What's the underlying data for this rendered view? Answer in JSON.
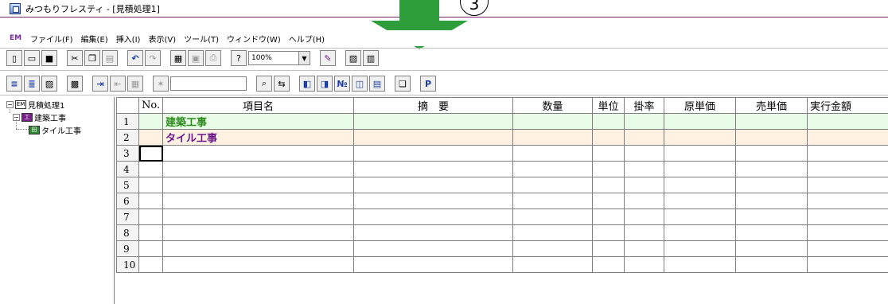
{
  "window": {
    "title": "みつもりフレスティ - [見積処理1]"
  },
  "annotation": {
    "label": "3"
  },
  "menu": [
    {
      "label": "ファイル(F)"
    },
    {
      "label": "編集(E)"
    },
    {
      "label": "挿入(I)"
    },
    {
      "label": "表示(V)"
    },
    {
      "label": "ツール(T)"
    },
    {
      "label": "ウィンドウ(W)"
    },
    {
      "label": "ヘルプ(H)"
    }
  ],
  "toolbar": {
    "zoom": "100%"
  },
  "tree": {
    "root": "見積処理1",
    "child": "建築工事",
    "grandchild": "タイル工事"
  },
  "grid": {
    "columns": [
      "No.",
      "項目名",
      "摘　要",
      "数量",
      "単位",
      "掛率",
      "原単価",
      "売単価",
      "実行金額"
    ],
    "rows": [
      {
        "num": "1",
        "no": "",
        "name": "建築工事"
      },
      {
        "num": "2",
        "no": "",
        "name": "タイル工事"
      },
      {
        "num": "3",
        "no": "",
        "name": ""
      },
      {
        "num": "4",
        "no": "",
        "name": ""
      },
      {
        "num": "5",
        "no": "",
        "name": ""
      },
      {
        "num": "6",
        "no": "",
        "name": ""
      },
      {
        "num": "7",
        "no": "",
        "name": ""
      },
      {
        "num": "8",
        "no": "",
        "name": ""
      },
      {
        "num": "9",
        "no": "",
        "name": ""
      },
      {
        "num": "10",
        "no": "",
        "name": ""
      }
    ]
  },
  "colors": {
    "arrow": "#2e9e3a",
    "green_row": "#e8fbe6",
    "peach_row": "#fff1e2",
    "name_purple": "#6a168a",
    "name_green": "#2e8b1e"
  }
}
